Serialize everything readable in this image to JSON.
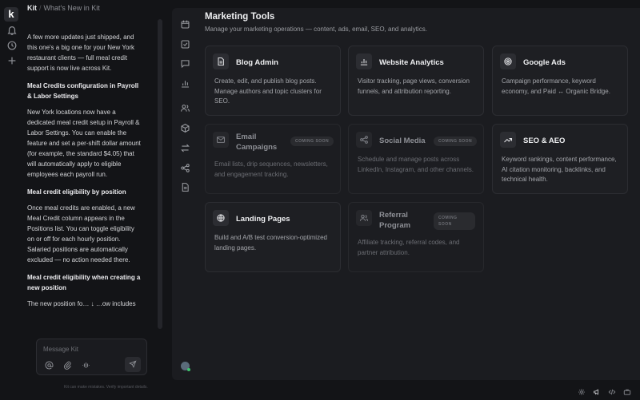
{
  "rail": {
    "logo": "k",
    "icons": [
      "bell-icon",
      "history-icon",
      "plus-icon"
    ]
  },
  "chat": {
    "breadcrumb": {
      "workspace": "Kit",
      "separator": "/",
      "page": "What's New in Kit"
    },
    "messages": [
      {
        "type": "p",
        "text": "A few more updates just shipped, and this one's a big one for your New York restaurant clients — full meal credit support is now live across Kit."
      },
      {
        "type": "h",
        "text": "Meal Credits configuration in Payroll & Labor Settings"
      },
      {
        "type": "p",
        "text": "New York locations now have a dedicated meal credit setup in Payroll & Labor Settings. You can enable the feature and set a per-shift dollar amount (for example, the standard $4.05) that will automatically apply to eligible employees each payroll run."
      },
      {
        "type": "h",
        "text": "Meal credit eligibility by position"
      },
      {
        "type": "p",
        "text": "Once meal credits are enabled, a new Meal Credit column appears in the Positions list. You can toggle eligibility on or off for each hourly position. Salaried positions are automatically excluded — no action needed there."
      },
      {
        "type": "h",
        "text": "Meal credit eligibility when creating a new position"
      },
      {
        "type": "p",
        "text": "The new position fo… ↓ …ow includes"
      }
    ],
    "scroll_down_icon": "arrow-down-icon",
    "composer": {
      "placeholder": "Message Kit",
      "icons": [
        "at-icon",
        "paperclip-icon",
        "waveform-icon",
        "send-icon"
      ]
    },
    "disclaimer": "Kit can make mistakes. Verify important details."
  },
  "tool_nav": {
    "icons": [
      "calendar-icon",
      "checklist-icon",
      "chat-icon",
      "bar-chart-icon",
      "users-icon",
      "cube-icon",
      "transfer-icon",
      "share-icon",
      "document-icon"
    ]
  },
  "main": {
    "title": "Marketing Tools",
    "subtitle": "Manage your marketing operations — content, ads, email, SEO, and analytics.",
    "cards": [
      {
        "title": "Blog Admin",
        "description": "Create, edit, and publish blog posts. Manage authors and topic clusters for SEO.",
        "icon": "document-icon",
        "badge": "",
        "enabled": true
      },
      {
        "title": "Website Analytics",
        "description": "Visitor tracking, page views, conversion funnels, and attribution reporting.",
        "icon": "bar-chart-icon",
        "badge": "",
        "enabled": true
      },
      {
        "title": "Google Ads",
        "description": "Campaign performance, keyword economy, and Paid ↔ Organic Bridge.",
        "icon": "target-icon",
        "badge": "",
        "enabled": true
      },
      {
        "title": "Email Campaigns",
        "description": "Email lists, drip sequences, newsletters, and engagement tracking.",
        "icon": "mail-icon",
        "badge": "COMING SOON",
        "enabled": false
      },
      {
        "title": "Social Media",
        "description": "Schedule and manage posts across LinkedIn, Instagram, and other channels.",
        "icon": "share-icon",
        "badge": "COMING SOON",
        "enabled": false
      },
      {
        "title": "SEO & AEO",
        "description": "Keyword rankings, content performance, AI citation monitoring, backlinks, and technical health.",
        "icon": "trend-up-icon",
        "badge": "",
        "enabled": true
      },
      {
        "title": "Landing Pages",
        "description": "Build and A/B test conversion-optimized landing pages.",
        "icon": "globe-icon",
        "badge": "",
        "enabled": true
      },
      {
        "title": "Referral Program",
        "description": "Affiliate tracking, referral codes, and partner attribution.",
        "icon": "users-icon",
        "badge": "COMING SOON",
        "enabled": false
      }
    ]
  },
  "bottom_bar": {
    "icons": [
      "gear-icon",
      "megaphone-icon",
      "code-icon",
      "briefcase-icon"
    ]
  }
}
